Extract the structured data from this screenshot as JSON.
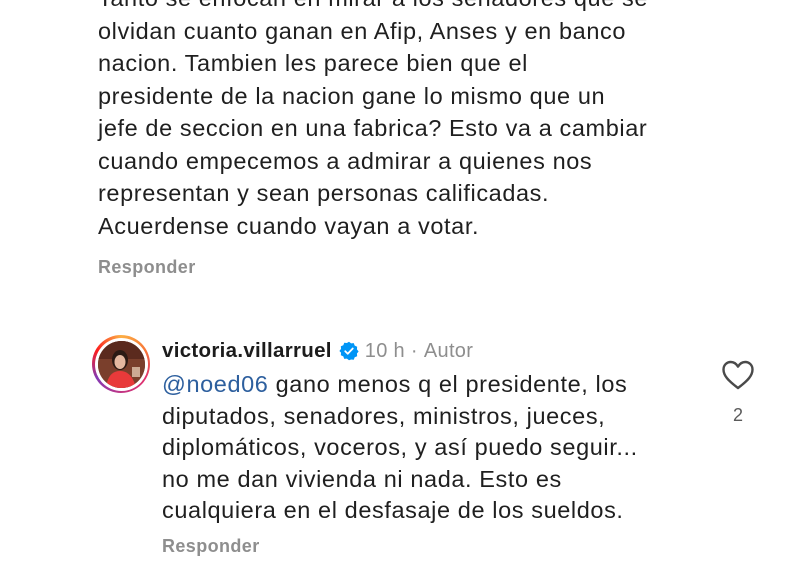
{
  "comment_1": {
    "text": "Tanto se enfocan en mirar a los senadores que se\nolvidan cuanto ganan en Afip, Anses y en banco\nnacion. Tambien les parece bien que el\npresidente de la nacion gane lo mismo que un\njefe de seccion en una fabrica? Esto va a cambiar\ncuando empecemos a admirar a quienes nos\nrepresentan y sean personas calificadas.\nAcuerdense cuando vayan a votar.",
    "reply_label": "Responder"
  },
  "comment_2": {
    "username": "victoria.villarruel",
    "time": "10 h",
    "separator": "·",
    "role": "Autor",
    "mention": "@noed06",
    "text": " gano menos q el presidente, los\ndiputados, senadores, ministros, jueces,\ndiplomáticos, voceros, y así puedo seguir...\nno me dan vivienda ni nada. Esto es\ncualquiera en el desfasaje de los sueldos.",
    "reply_label": "Responder",
    "like_count": "2",
    "icons": {
      "verified": "verified-badge-icon",
      "like": "heart-icon"
    },
    "colors": {
      "verified": "#0095f6",
      "mention": "#385898"
    }
  }
}
